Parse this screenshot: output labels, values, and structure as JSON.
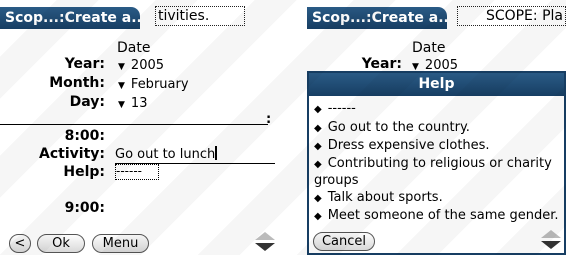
{
  "left": {
    "title": "Scop...:Create a...",
    "title_field": "tivities.",
    "date_header": "Date",
    "year_label": "Year:",
    "year_value": "2005",
    "month_label": "Month:",
    "month_value": "February",
    "day_label": "Day:",
    "day_value": "13",
    "colon_marker": ":",
    "time1": "8:00:",
    "activity_label": "Activity:",
    "activity_value": "Go out to lunch",
    "help_label": "Help:",
    "help_value": "------",
    "time2": "9:00:",
    "back_button": "<",
    "ok_button": "Ok",
    "menu_button": "Menu"
  },
  "right": {
    "title": "Scop...:Create a...",
    "title_field": "SCOPE: Pla",
    "date_header": "Date",
    "year_label": "Year:",
    "year_value": "2005",
    "help_title": "Help",
    "help_items": [
      "------",
      "Go out to the country.",
      "Dress expensive clothes.",
      "Contributing to religious or charity groups",
      "Talk about sports.",
      "Meet someone of the same gender."
    ],
    "cancel_button": "Cancel"
  }
}
